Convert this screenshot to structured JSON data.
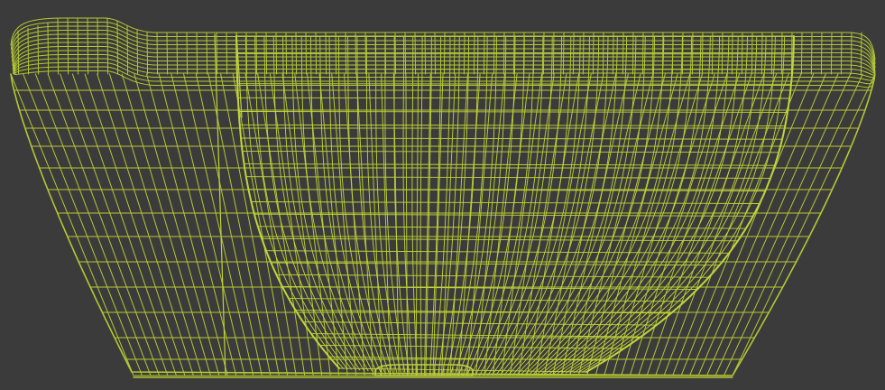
{
  "viewport": {
    "background_color": "#3b3b3b"
  },
  "model": {
    "kind": "bathtub-wireframe",
    "display_mode": "wireframe",
    "wire_color": "#b4c832",
    "wire_color_dense": "#c2d43c"
  }
}
